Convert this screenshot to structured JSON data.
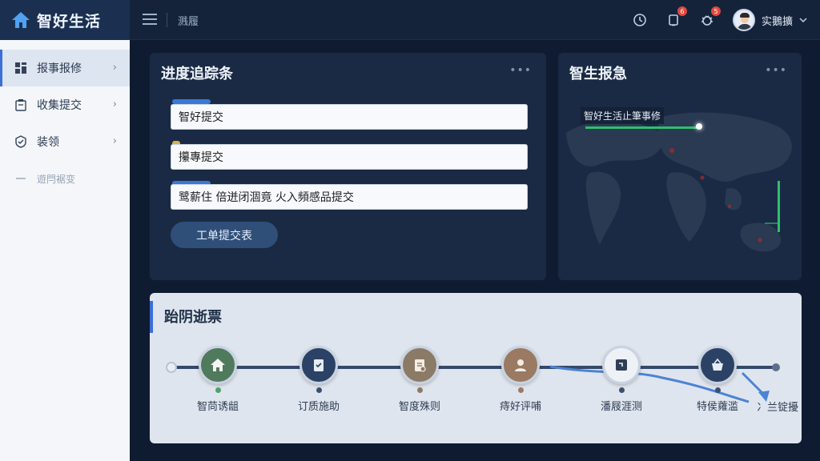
{
  "app": {
    "brand_name": "智好生活",
    "breadcrumb": "溅履"
  },
  "topbar": {
    "notifications_badge": "6",
    "bugs_badge": "5",
    "user_name": "实鵝擴"
  },
  "sidebar": {
    "items": [
      {
        "label": "报事报修",
        "icon": "grid-icon",
        "active": true
      },
      {
        "label": "收集提交",
        "icon": "clipboard-icon",
        "active": false
      },
      {
        "label": "装领",
        "icon": "shield-check-icon",
        "active": false
      },
      {
        "label": "遊閂裾变",
        "icon": "dash-icon",
        "active": false
      }
    ]
  },
  "progress_panel": {
    "title": "进度追踪条",
    "fields": [
      {
        "value": "智好提交"
      },
      {
        "value": "攥專提交"
      },
      {
        "value": "鹭薪住 倍迸闭涸竟 火入頻感品提交"
      }
    ],
    "submit_label": "工单提交表"
  },
  "map_panel": {
    "title": "智生报急",
    "callout": "智好生活止筆事修"
  },
  "flow_panel": {
    "title": "跆阴逝票",
    "steps": [
      {
        "label": "智苘诱龃",
        "icon": "house-icon",
        "color": "#4f7a5c",
        "pip": "#4aa36b"
      },
      {
        "label": "订质施助",
        "icon": "document-check-icon",
        "color": "#2b4266",
        "pip": "#3a4f70"
      },
      {
        "label": "智度殊则",
        "icon": "document-icon",
        "color": "#8b7a66",
        "pip": "#8b7a66"
      },
      {
        "label": "痔好评哺",
        "icon": "person-icon",
        "color": "#9a7a62",
        "pip": "#9a7a62"
      },
      {
        "label": "潘屐涯测",
        "icon": "puzzle-icon",
        "color": "#2e3e58",
        "pip": "#3a4f70"
      },
      {
        "label": "特侯蕹滥",
        "icon": "basket-icon",
        "color": "#2b4266",
        "pip": "#3a4f70"
      }
    ],
    "last_label": "冫兰锭擾"
  },
  "colors": {
    "accent": "#3a6fd8",
    "bg": "#0f1b30",
    "panel": "#1a2a44",
    "green": "#2fbf6c"
  }
}
